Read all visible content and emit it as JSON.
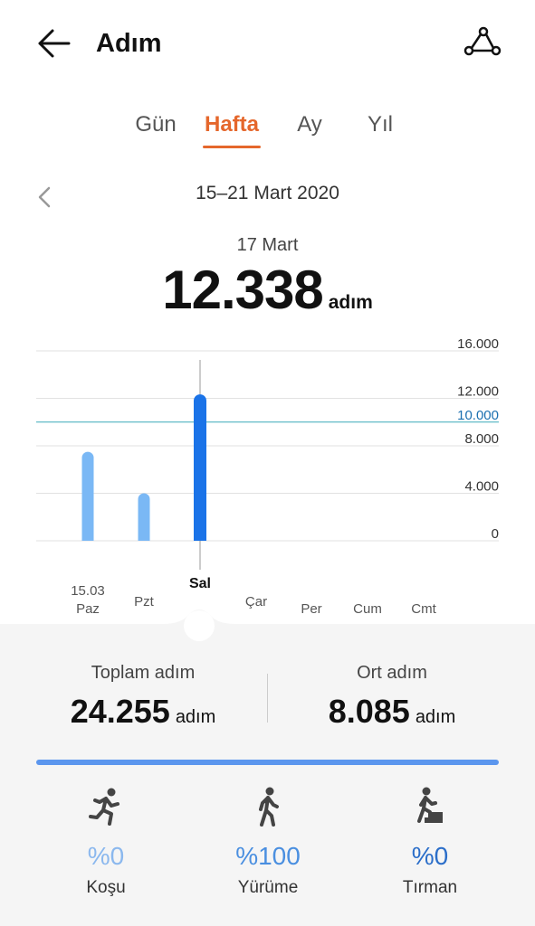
{
  "header": {
    "title": "Adım",
    "back_icon": "arrow-left-icon",
    "share_icon": "share-icon"
  },
  "tabs": [
    {
      "label": "Gün",
      "active": false
    },
    {
      "label": "Hafta",
      "active": true
    },
    {
      "label": "Ay",
      "active": false
    },
    {
      "label": "Yıl",
      "active": false
    }
  ],
  "date_range": "15–21 Mart 2020",
  "selected": {
    "date": "17 Mart",
    "steps": "12.338",
    "unit": "adım"
  },
  "chart_data": {
    "type": "bar",
    "categories": [
      "Paz",
      "Pzt",
      "Sal",
      "Çar",
      "Per",
      "Cum",
      "Cmt"
    ],
    "first_date_label": "15.03",
    "values": [
      7500,
      4000,
      12338,
      0,
      0,
      0,
      0
    ],
    "selected_index": 2,
    "y_ticks": [
      "16.000",
      "12.000",
      "8.000",
      "4.000",
      "0"
    ],
    "y_tick_values": [
      16000,
      12000,
      8000,
      4000,
      0
    ],
    "goal_value": 10000,
    "goal_label": "10.000",
    "ylim": [
      0,
      16000
    ],
    "colors": {
      "bar": "#7ab8f5",
      "selected_bar": "#1a73e8",
      "goal_line": "#3aa9b9",
      "goal_label": "#1a6fb0"
    }
  },
  "stats": {
    "total": {
      "label": "Toplam adım",
      "value": "24.255",
      "unit": "adım"
    },
    "average": {
      "label": "Ort adım",
      "value": "8.085",
      "unit": "adım"
    }
  },
  "activities": [
    {
      "name": "Koşu",
      "percent": "%0",
      "icon": "running-icon",
      "color": "#8bb8ee"
    },
    {
      "name": "Yürüme",
      "percent": "%100",
      "icon": "walking-icon",
      "color": "#4a8fe0"
    },
    {
      "name": "Tırman",
      "percent": "%0",
      "icon": "climbing-icon",
      "color": "#2b6ec9"
    }
  ]
}
